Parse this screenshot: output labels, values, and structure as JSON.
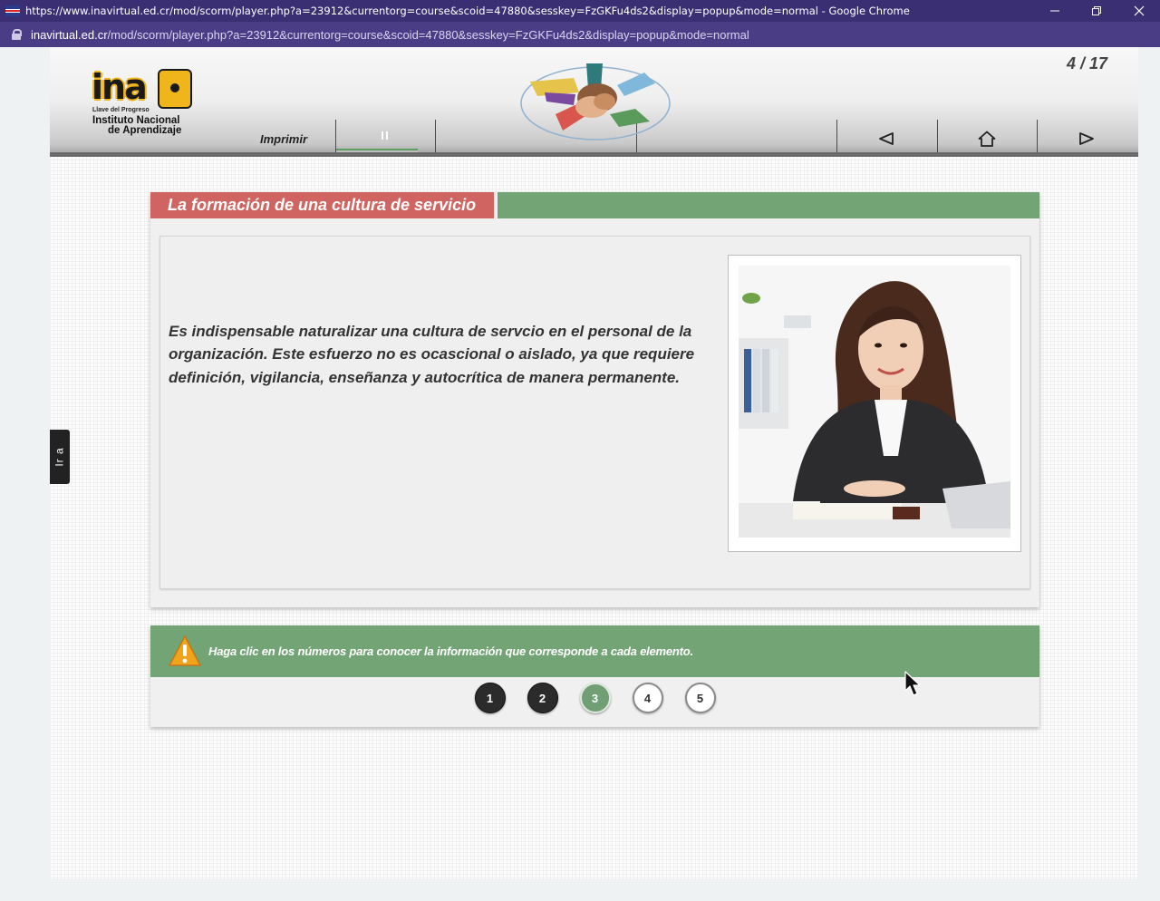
{
  "browser": {
    "title": "https://www.inavirtual.ed.cr/mod/scorm/player.php?a=23912&currentorg=course&scoid=47880&sesskey=FzGKFu4ds2&display=popup&mode=normal - Google Chrome",
    "url_host": "inavirtual.ed.cr",
    "url_path": "/mod/scorm/player.php?a=23912&currentorg=course&scoid=47880&sesskey=FzGKFu4ds2&display=popup&mode=normal"
  },
  "header": {
    "logo_word": "ina",
    "logo_tagline": "Llave del Progreso",
    "logo_line1": "Instituto Nacional",
    "logo_line2": "de Aprendizaje",
    "print_label": "Imprimir",
    "page_indicator": "4 / 17",
    "audio_progress": 0.82
  },
  "side_tab": {
    "label": "Ir a"
  },
  "content": {
    "title": "La formación de una cultura de servicio",
    "body": "Es indispensable naturalizar una cultura de servcio en el personal de la organización. Este esfuerzo no es ocascional o aislado, ya que requiere definición, vigilancia, enseñanza y autocrítica de manera permanente."
  },
  "instructions": {
    "text": "Haga clic en los números para conocer la información que corresponde a cada elemento."
  },
  "number_buttons": [
    {
      "label": "1",
      "state": "visited"
    },
    {
      "label": "2",
      "state": "visited"
    },
    {
      "label": "3",
      "state": "active"
    },
    {
      "label": "4",
      "state": "fresh"
    },
    {
      "label": "5",
      "state": "fresh"
    }
  ],
  "colors": {
    "title_red": "#cf6460",
    "accent_green": "#72a476",
    "browser_purple": "#3b2f73"
  },
  "icons": [
    "lock-icon",
    "minimize-icon",
    "restore-icon",
    "close-icon",
    "pause-icon",
    "prev-arrow-icon",
    "home-icon",
    "next-arrow-icon",
    "warning-icon"
  ]
}
